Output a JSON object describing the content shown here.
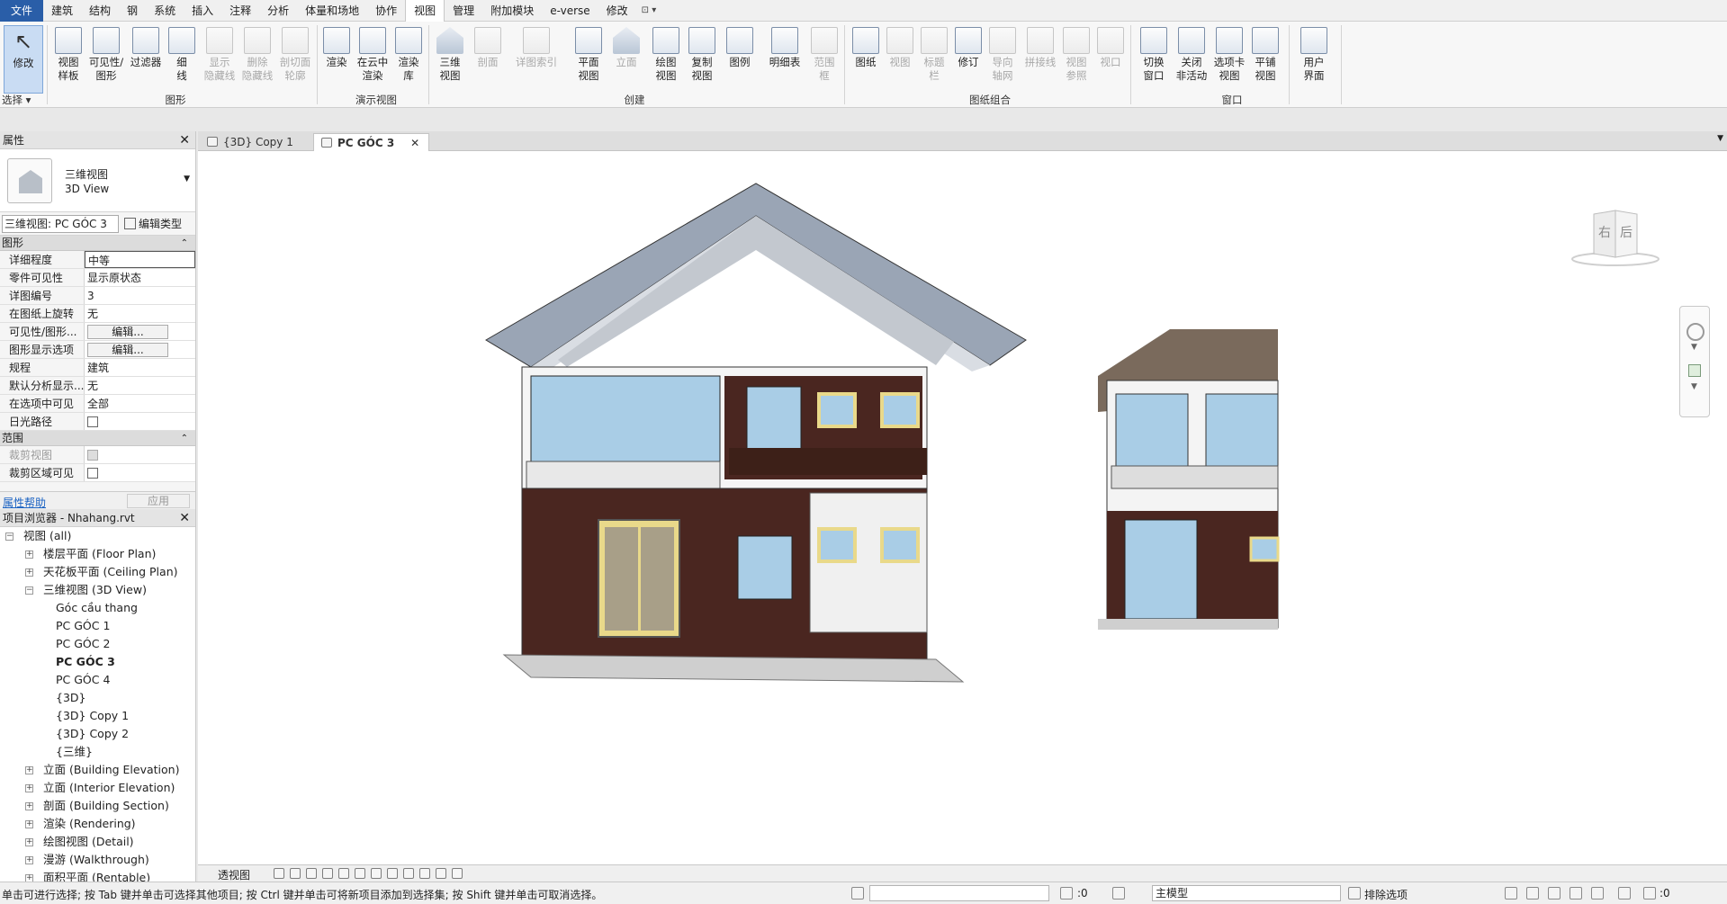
{
  "menu": {
    "file": "文件",
    "tabs": [
      "建筑",
      "结构",
      "钢",
      "系统",
      "插入",
      "注释",
      "分析",
      "体量和场地",
      "协作",
      "视图",
      "管理",
      "附加模块",
      "e-verse",
      "修改"
    ],
    "active_tab": "视图",
    "extra": "⊡ ▾"
  },
  "ribbon": {
    "modify": "修改",
    "select": "选择 ▾",
    "view_template": [
      "视图",
      "样板"
    ],
    "visibility": [
      "可见性/",
      "图形"
    ],
    "filters": "过滤器",
    "thin_lines": [
      "细",
      "线"
    ],
    "show_hidden": [
      "显示",
      "隐藏线"
    ],
    "remove_hidden": [
      "删除",
      "隐藏线"
    ],
    "cut_profile": [
      "剖切面",
      "轮廓"
    ],
    "graphics_group": "图形",
    "render": "渲染",
    "render_cloud": [
      "在云中",
      "渲染"
    ],
    "render_gallery": [
      "渲染",
      "库"
    ],
    "presentation_group": "演示视图",
    "three_d": [
      "三维",
      "视图"
    ],
    "section": "剖面",
    "callout": "详图索引",
    "plan_views": [
      "平面",
      "视图"
    ],
    "elevation": "立面",
    "drafting": [
      "绘图",
      "视图"
    ],
    "duplicate": [
      "复制",
      "视图"
    ],
    "legends": "图例",
    "schedules": "明细表",
    "scope_box": [
      "范围",
      "框"
    ],
    "create_group": "创建",
    "sheet": "图纸",
    "view": "视图",
    "title_block": [
      "标题",
      "栏"
    ],
    "revisions": "修订",
    "guide_grid": [
      "导向",
      "轴网"
    ],
    "matchline": "拼接线",
    "view_reference": [
      "视图",
      "参照"
    ],
    "viewports": "视口",
    "sheet_group": "图纸组合",
    "switch_windows": [
      "切换",
      "窗口"
    ],
    "close_inactive": [
      "关闭",
      "非活动"
    ],
    "tab_views": [
      "选项卡",
      "视图"
    ],
    "tile_views": [
      "平铺",
      "视图"
    ],
    "windows_group": "窗口",
    "user_interface": [
      "用户",
      "界面"
    ]
  },
  "view_tabs": [
    {
      "label": "{3D} Copy 1",
      "active": false
    },
    {
      "label": "PC GÓC 3",
      "active": true
    }
  ],
  "properties": {
    "title": "属性",
    "type_name": [
      "三维视图",
      "3D View"
    ],
    "view_selector": "三维视图: PC GÓC 3",
    "edit_type": "编辑类型",
    "graphics_section": "图形",
    "rows": [
      {
        "k": "详细程度",
        "v": "中等"
      },
      {
        "k": "零件可见性",
        "v": "显示原状态"
      },
      {
        "k": "详图编号",
        "v": "3"
      },
      {
        "k": "在图纸上旋转",
        "v": "无"
      },
      {
        "k": "可见性/图形...",
        "v": "编辑..."
      },
      {
        "k": "图形显示选项",
        "v": "编辑..."
      },
      {
        "k": "规程",
        "v": "建筑"
      },
      {
        "k": "默认分析显示...",
        "v": "无"
      },
      {
        "k": "在选项中可见",
        "v": "全部"
      },
      {
        "k": "日光路径",
        "v": ""
      }
    ],
    "extents_section": "范围",
    "extent_rows": [
      {
        "k": "裁剪视图",
        "v": ""
      },
      {
        "k": "裁剪区域可见",
        "v": ""
      }
    ],
    "help": "属性帮助",
    "apply": "应用"
  },
  "browser": {
    "title": "项目浏览器 - Nhahang.rvt",
    "items": [
      {
        "label": "视图 (all)",
        "level": 0,
        "exp": "−"
      },
      {
        "label": "楼层平面 (Floor Plan)",
        "level": 1,
        "exp": "+"
      },
      {
        "label": "天花板平面 (Ceiling Plan)",
        "level": 1,
        "exp": "+"
      },
      {
        "label": "三维视图 (3D View)",
        "level": 1,
        "exp": "−"
      },
      {
        "label": "Góc cầu thang",
        "level": 2,
        "exp": ""
      },
      {
        "label": "PC GÓC 1",
        "level": 2,
        "exp": ""
      },
      {
        "label": "PC GÓC 2",
        "level": 2,
        "exp": ""
      },
      {
        "label": "PC GÓC 3",
        "level": 2,
        "exp": "",
        "bold": true
      },
      {
        "label": "PC GÓC 4",
        "level": 2,
        "exp": ""
      },
      {
        "label": "{3D}",
        "level": 2,
        "exp": ""
      },
      {
        "label": "{3D} Copy 1",
        "level": 2,
        "exp": ""
      },
      {
        "label": "{3D} Copy 2",
        "level": 2,
        "exp": ""
      },
      {
        "label": "{三维}",
        "level": 2,
        "exp": ""
      },
      {
        "label": "立面 (Building Elevation)",
        "level": 1,
        "exp": "+"
      },
      {
        "label": "立面 (Interior Elevation)",
        "level": 1,
        "exp": "+"
      },
      {
        "label": "剖面 (Building Section)",
        "level": 1,
        "exp": "+"
      },
      {
        "label": "渲染 (Rendering)",
        "level": 1,
        "exp": "+"
      },
      {
        "label": "绘图视图 (Detail)",
        "level": 1,
        "exp": "+"
      },
      {
        "label": "漫游 (Walkthrough)",
        "level": 1,
        "exp": "+"
      },
      {
        "label": "面积平面 (Rentable)",
        "level": 1,
        "exp": "+"
      }
    ]
  },
  "viewcube": {
    "left": "右",
    "back": "后"
  },
  "view_control": {
    "label": "透视图"
  },
  "status": {
    "message": "单击可进行选择; 按 Tab 键并单击可选择其他项目; 按 Ctrl 键并单击可将新项目添加到选择集; 按 Shift 键并单击可取消选择。",
    "zero_a": ":0",
    "model": "主模型",
    "exclude": "排除选项",
    "filter_count": ":0"
  },
  "colors": {
    "accent": "#2a5ea8",
    "brick": "#4a2620",
    "roof": "#9aa5b5",
    "frame": "#e9d98a",
    "glass": "#a9cde6"
  }
}
